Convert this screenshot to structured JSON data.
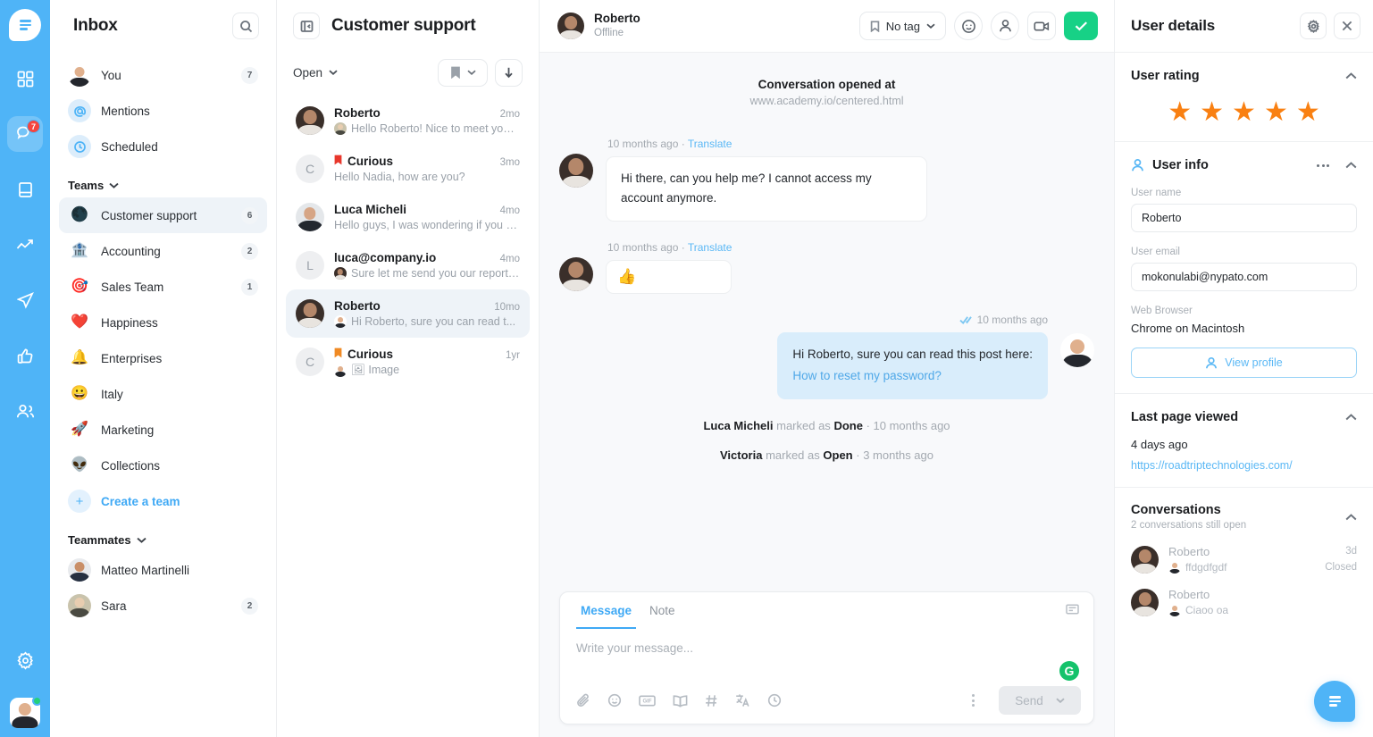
{
  "rail": {
    "logo": "brand-logo",
    "items": [
      {
        "name": "grid-icon"
      },
      {
        "name": "chat-icon",
        "badge": "7",
        "active": true
      },
      {
        "name": "book-icon"
      },
      {
        "name": "trending-icon"
      },
      {
        "name": "send-icon"
      },
      {
        "name": "thumbs-up-icon"
      },
      {
        "name": "users-icon"
      }
    ],
    "settings": "gear-icon",
    "avatar": "user-avatar"
  },
  "inbox": {
    "title": "Inbox",
    "search_icon": "search-icon",
    "nav": [
      {
        "label": "You",
        "count": "7",
        "icon": "avatar"
      },
      {
        "label": "Mentions",
        "count": "",
        "icon": "at-icon"
      },
      {
        "label": "Scheduled",
        "count": "",
        "icon": "clock-icon"
      }
    ],
    "teams_header": "Teams",
    "teams": [
      {
        "label": "Customer support",
        "count": "6",
        "emoji": "🌑",
        "selected": true
      },
      {
        "label": "Accounting",
        "count": "2",
        "emoji": "🏦"
      },
      {
        "label": "Sales Team",
        "count": "1",
        "emoji": "🎯"
      },
      {
        "label": "Happiness",
        "count": "",
        "emoji": "❤️"
      },
      {
        "label": "Enterprises",
        "count": "",
        "emoji": "🔔"
      },
      {
        "label": "Italy",
        "count": "",
        "emoji": "😀"
      },
      {
        "label": "Marketing",
        "count": "",
        "emoji": "🚀"
      },
      {
        "label": "Collections",
        "count": "",
        "emoji": "👽"
      }
    ],
    "create_team": "Create a team",
    "teammates_header": "Teammates",
    "teammates": [
      {
        "label": "Matteo Martinelli",
        "count": ""
      },
      {
        "label": "Sara",
        "count": "2"
      }
    ]
  },
  "convlist": {
    "title": "Customer support",
    "panel_icon": "collapse-panel-icon",
    "filter": "Open",
    "bookmark_icon": "bookmark-icon",
    "sort_icon": "sort-down-icon",
    "items": [
      {
        "name": "Roberto",
        "time": "2mo",
        "preview": "Hello Roberto! Nice to meet you. ...",
        "avatar": "rob",
        "bookmark": "",
        "has_mini": true
      },
      {
        "name": "Curious",
        "time": "3mo",
        "preview": "Hello Nadia, how are you?",
        "avatar": "C",
        "bookmark": "#E8372C",
        "has_mini": false
      },
      {
        "name": "Luca Micheli",
        "time": "4mo",
        "preview": "Hello guys, I was wondering if you c...",
        "avatar": "luca",
        "bookmark": "",
        "has_mini": false
      },
      {
        "name": "luca@company.io",
        "time": "4mo",
        "preview": "Sure let me send you our report a...",
        "avatar": "L",
        "bookmark": "",
        "has_mini": true
      },
      {
        "name": "Roberto",
        "time": "10mo",
        "preview": "Hi Roberto, sure you can read t...",
        "avatar": "rob",
        "bookmark": "",
        "has_mini": true,
        "selected": true
      },
      {
        "name": "Curious",
        "time": "1yr",
        "preview": "🖼 Image",
        "avatar": "C",
        "bookmark": "#F08A24",
        "has_mini": true
      }
    ]
  },
  "chat": {
    "user_name": "Roberto",
    "user_status": "Offline",
    "tag_label": "No tag",
    "emoji_icon": "emoji-icon",
    "assign_icon": "person-icon",
    "video_icon": "video-camera-icon",
    "done_icon": "check-icon",
    "opened_title": "Conversation opened at",
    "opened_url": "www.academy.io/centered.html",
    "messages": [
      {
        "dir": "in",
        "time": "10 months ago",
        "translate": "Translate",
        "text": "Hi there, can you help me? I cannot access my account anymore.",
        "avatar": "rob"
      },
      {
        "dir": "in",
        "time": "10 months ago",
        "translate": "Translate",
        "text": "👍",
        "emoji": true,
        "avatar": "rob"
      },
      {
        "dir": "out",
        "time": "10 months ago",
        "text": "Hi Roberto, sure you can read this post here:",
        "link": "How to reset my password?",
        "avatar": "me"
      }
    ],
    "system_lines": [
      {
        "actor": "Luca Micheli",
        "mid": "marked as",
        "state": "Done",
        "time": "10 months ago"
      },
      {
        "actor": "Victoria",
        "mid": "marked as",
        "state": "Open",
        "time": "3 months ago"
      }
    ],
    "composer": {
      "tab_message": "Message",
      "tab_note": "Note",
      "placeholder": "Write your message...",
      "keyboard_icon": "keyboard-icon",
      "tools": [
        "attachment-icon",
        "emoji-icon",
        "gif-icon",
        "knowledge-base-icon",
        "hashtag-icon",
        "translate-icon",
        "schedule-icon"
      ],
      "grammarly": "G",
      "send_label": "Send"
    }
  },
  "details": {
    "title": "User details",
    "gear_icon": "gear-icon",
    "close_icon": "close-icon",
    "rating": {
      "title": "User rating",
      "stars": 5,
      "color": "#F98012"
    },
    "user_info": {
      "title": "User info",
      "person_icon": "person-icon",
      "name_label": "User name",
      "name_value": "Roberto",
      "email_label": "User email",
      "email_value": "mokonulabi@nypato.com",
      "browser_label": "Web Browser",
      "browser_value": "Chrome on Macintosh",
      "view_profile": "View profile"
    },
    "last_page": {
      "title": "Last page viewed",
      "time": "4 days ago",
      "url": "https://roadtriptechnologies.com/"
    },
    "conversations": {
      "title": "Conversations",
      "subtitle": "2 conversations still open",
      "items": [
        {
          "name": "Roberto",
          "preview": "ffdgdfgdf",
          "time": "3d",
          "status": "Closed"
        },
        {
          "name": "Roberto",
          "preview": "Ciaoo oa",
          "time": "",
          "status": ""
        }
      ]
    },
    "fab": "chat-fab"
  }
}
